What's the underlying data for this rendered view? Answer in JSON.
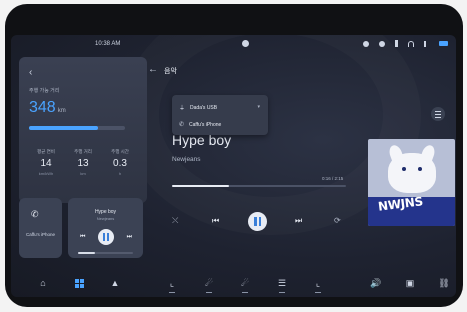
{
  "status_bar": {
    "time": "10:38 AM",
    "icons": [
      "person-icon",
      "location-icon",
      "lock-icon",
      "bluetooth-icon",
      "wifi-icon",
      "signal-icon",
      "battery-icon"
    ],
    "battery_color": "#4aa3ff"
  },
  "info_card": {
    "range_label": "주행 가능 거리",
    "range_value": "348",
    "range_unit": "km",
    "range_fraction": 0.72,
    "stats": [
      {
        "label": "평균 연비",
        "value": "14",
        "unit": "km/kWh"
      },
      {
        "label": "주행 거리",
        "value": "13",
        "unit": "km"
      },
      {
        "label": "주행 시간",
        "value": "0.3",
        "unit": "h"
      }
    ]
  },
  "phone_card": {
    "label": "Caffu's iPhone"
  },
  "mini_player": {
    "title": "Hype boy",
    "artist": "Newjeans",
    "progress": 0.3
  },
  "music": {
    "header": "음악",
    "sources": [
      "Dada's USB",
      "Caffu's iPhone"
    ],
    "title": "Hype boy",
    "artist": "Newjeans",
    "time": "0:16 / 2:15",
    "progress": 0.33,
    "album_text": "NWJNS",
    "controls": [
      "shuffle-icon",
      "previous-icon",
      "pause-icon",
      "next-icon",
      "repeat-icon"
    ]
  },
  "accent_color": "#4aa3ff",
  "bottom_nav": [
    "home-icon",
    "apps-icon",
    "navigation-icon",
    "seat-icon",
    "climate-icon",
    "fan-icon",
    "defrost-icon",
    "seat-heat-icon",
    "volume-icon",
    "media-icon",
    "car-icon"
  ]
}
